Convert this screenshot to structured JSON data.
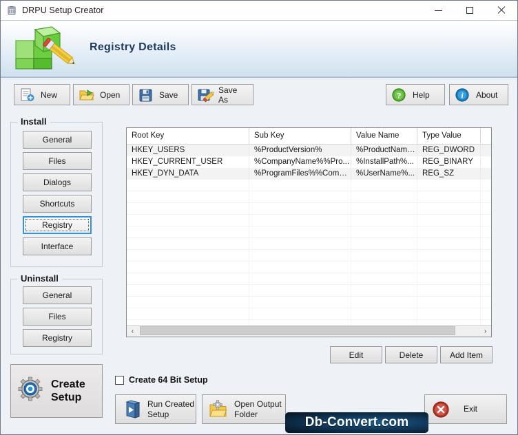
{
  "window": {
    "title": "DRPU Setup Creator",
    "app_icon": "setup-creator-icon",
    "minimize_label": "Minimize",
    "maximize_label": "Maximize",
    "close_label": "Close"
  },
  "header": {
    "title": "Registry Details",
    "logo_icon": "green-cubes-pencil-logo"
  },
  "toolbar": {
    "buttons": [
      {
        "label": "New",
        "icon": "new-document-icon"
      },
      {
        "label": "Open",
        "icon": "open-folder-icon"
      },
      {
        "label": "Save",
        "icon": "floppy-disk-icon"
      },
      {
        "label": "Save As",
        "icon": "floppy-disk-pencil-icon"
      }
    ],
    "right_buttons": [
      {
        "label": "Help",
        "icon": "question-mark-icon"
      },
      {
        "label": "About",
        "icon": "info-icon"
      }
    ]
  },
  "sidebar": {
    "install": {
      "title": "Install",
      "items": [
        {
          "label": "General",
          "active": false
        },
        {
          "label": "Files",
          "active": false
        },
        {
          "label": "Dialogs",
          "active": false
        },
        {
          "label": "Shortcuts",
          "active": false
        },
        {
          "label": "Registry",
          "active": true
        },
        {
          "label": "Interface",
          "active": false
        }
      ]
    },
    "uninstall": {
      "title": "Uninstall",
      "items": [
        {
          "label": "General",
          "active": false
        },
        {
          "label": "Files",
          "active": false
        },
        {
          "label": "Registry",
          "active": false
        }
      ]
    },
    "create_setup": {
      "line1": "Create",
      "line2": "Setup",
      "icon": "gear-settings-icon"
    }
  },
  "grid": {
    "columns": [
      "Root Key",
      "Sub Key",
      "Value Name",
      "Type Value",
      ""
    ],
    "rows": [
      [
        "HKEY_USERS",
        "%ProductVersion%",
        "%ProductName%",
        "REG_DWORD",
        ""
      ],
      [
        "HKEY_CURRENT_USER",
        "%CompanyName%%Pro...",
        "%InstallPath%...",
        "REG_BINARY",
        ""
      ],
      [
        "HKEY_DYN_DATA",
        "%ProgramFiles%%Comm...",
        "%UserName%...",
        "REG_SZ",
        ""
      ]
    ],
    "blank_row_count": 13,
    "scrollbar": {
      "left_arrow": "‹",
      "right_arrow": "›"
    }
  },
  "grid_actions": [
    {
      "label": "Edit"
    },
    {
      "label": "Delete"
    },
    {
      "label": "Add Item"
    }
  ],
  "options": {
    "create_64bit": {
      "label": "Create 64 Bit Setup",
      "checked": false
    }
  },
  "bottom_buttons": [
    {
      "line1": "Run Created",
      "line2": "Setup",
      "icon": "run-setup-icon"
    },
    {
      "line1": "Open Output",
      "line2": "Folder",
      "icon": "output-folder-icon"
    }
  ],
  "exit_button": {
    "label": "Exit",
    "icon": "close-circle-icon"
  },
  "watermark": {
    "text": "Db-Convert.com"
  },
  "colors": {
    "accent_blue": "#2f93e0",
    "header_text": "#1f3a5f",
    "panel_bg": "#eef2f7",
    "grid_row_alt": "#f3f3f3",
    "exit_red": "#c0392b",
    "help_green": "#4aa02c",
    "about_blue": "#1a7fc1"
  }
}
